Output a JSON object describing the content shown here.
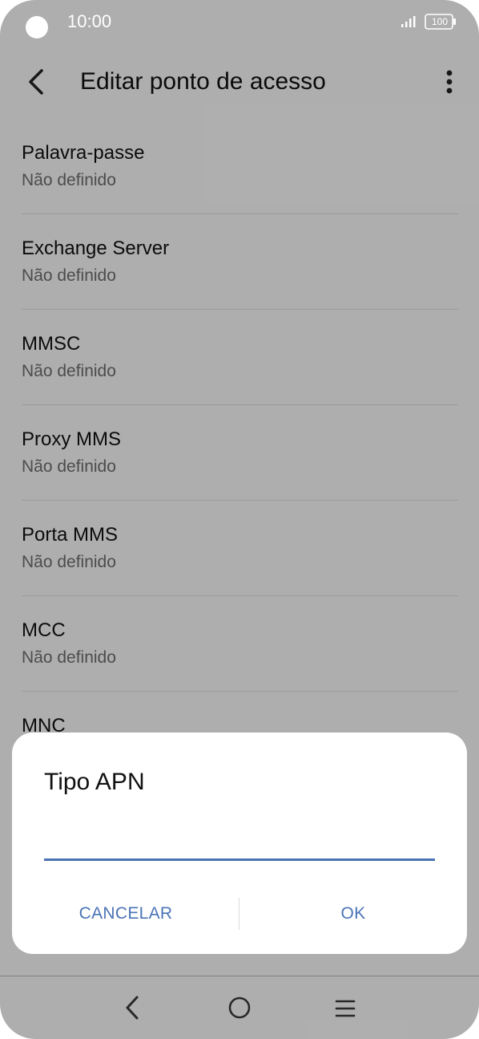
{
  "status_bar": {
    "time": "10:00",
    "battery": "100"
  },
  "app_bar": {
    "title": "Editar ponto de acesso"
  },
  "settings": [
    {
      "title": "Palavra-passe",
      "value": "Não definido"
    },
    {
      "title": "Exchange Server",
      "value": "Não definido"
    },
    {
      "title": "MMSC",
      "value": "Não definido"
    },
    {
      "title": "Proxy MMS",
      "value": "Não definido"
    },
    {
      "title": "Porta MMS",
      "value": "Não definido"
    },
    {
      "title": "MCC",
      "value": "Não definido"
    },
    {
      "title": "MNC",
      "value": ""
    }
  ],
  "dialog": {
    "title": "Tipo APN",
    "input_value": "",
    "cancel_label": "CANCELAR",
    "ok_label": "OK"
  },
  "colors": {
    "accent": "#4a74b5",
    "scrim": "rgba(0,0,0,0.30)"
  },
  "icons": {
    "back": "back-arrow-icon",
    "more": "more-vert-icon",
    "nav_back": "nav-back-icon",
    "nav_home": "nav-home-icon",
    "nav_recents": "nav-recents-icon"
  }
}
